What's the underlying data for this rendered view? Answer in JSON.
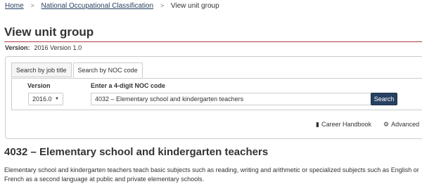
{
  "breadcrumb": {
    "home": "Home",
    "sep1": ">",
    "noc": "National Occupational Classification",
    "sep2": ">",
    "current": "View unit group"
  },
  "page_title": "View unit group",
  "version": {
    "label": "Version:",
    "value": "2016 Version 1.0"
  },
  "tabs": [
    {
      "label": "Search by job title",
      "active": false
    },
    {
      "label": "Search by NOC code",
      "active": true
    }
  ],
  "form": {
    "version_label": "Version",
    "version_value": "2016.0",
    "noc_label": "Enter a 4-digit NOC code",
    "noc_value": "4032 – Elementary school and kindergarten teachers",
    "search_label": "Search"
  },
  "links": {
    "career": "Career Handbook",
    "advanced": "Advanced"
  },
  "result": {
    "title": "4032 – Elementary school and kindergarten teachers",
    "description": "Elementary school and kindergarten teachers teach basic subjects such as reading, writing and arithmetic or specialized subjects such as English or French as a second language at public and private elementary schools."
  },
  "colors": {
    "link": "#284162",
    "accent_rule": "#af3c43",
    "button": "#284162"
  }
}
